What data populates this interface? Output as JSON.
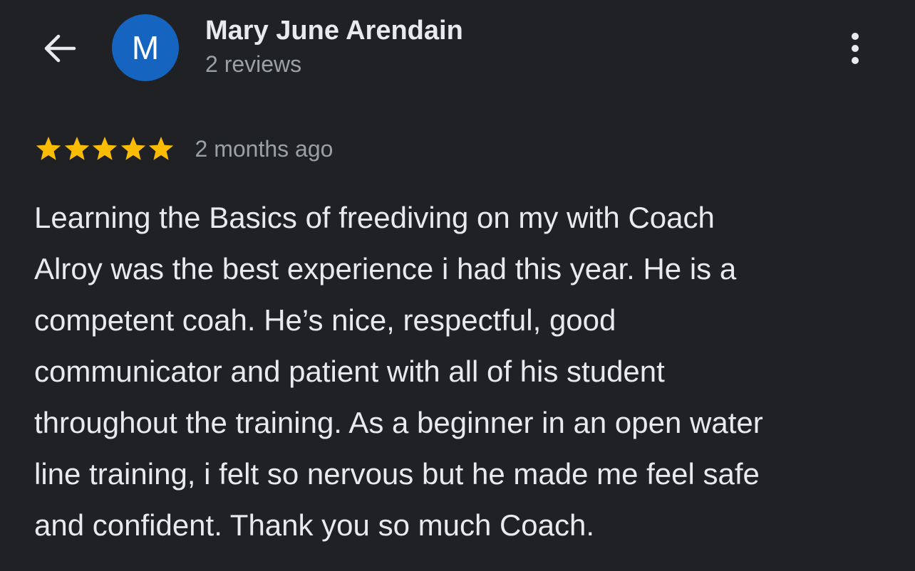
{
  "header": {
    "back_icon": "arrow-left-icon",
    "avatar_letter": "M",
    "avatar_color": "#1565c0",
    "reviewer_name": "Mary June Arendain",
    "review_count": "2 reviews",
    "more_icon": "more-vertical-icon"
  },
  "review": {
    "rating": 5,
    "rating_max": 5,
    "star_color": "#fbbc04",
    "date": "2 months ago",
    "text_lines": [
      "Learning the Basics of freediving on my with Coach",
      "Alroy was the best experience i had this year. He is a",
      "competent coah. He’s nice, respectful, good",
      "communicator and patient with all of his student",
      "throughout the training. As a beginner in an open water",
      "line training, i felt so nervous but he made me feel safe",
      "and confident. Thank you so much Coach."
    ]
  }
}
